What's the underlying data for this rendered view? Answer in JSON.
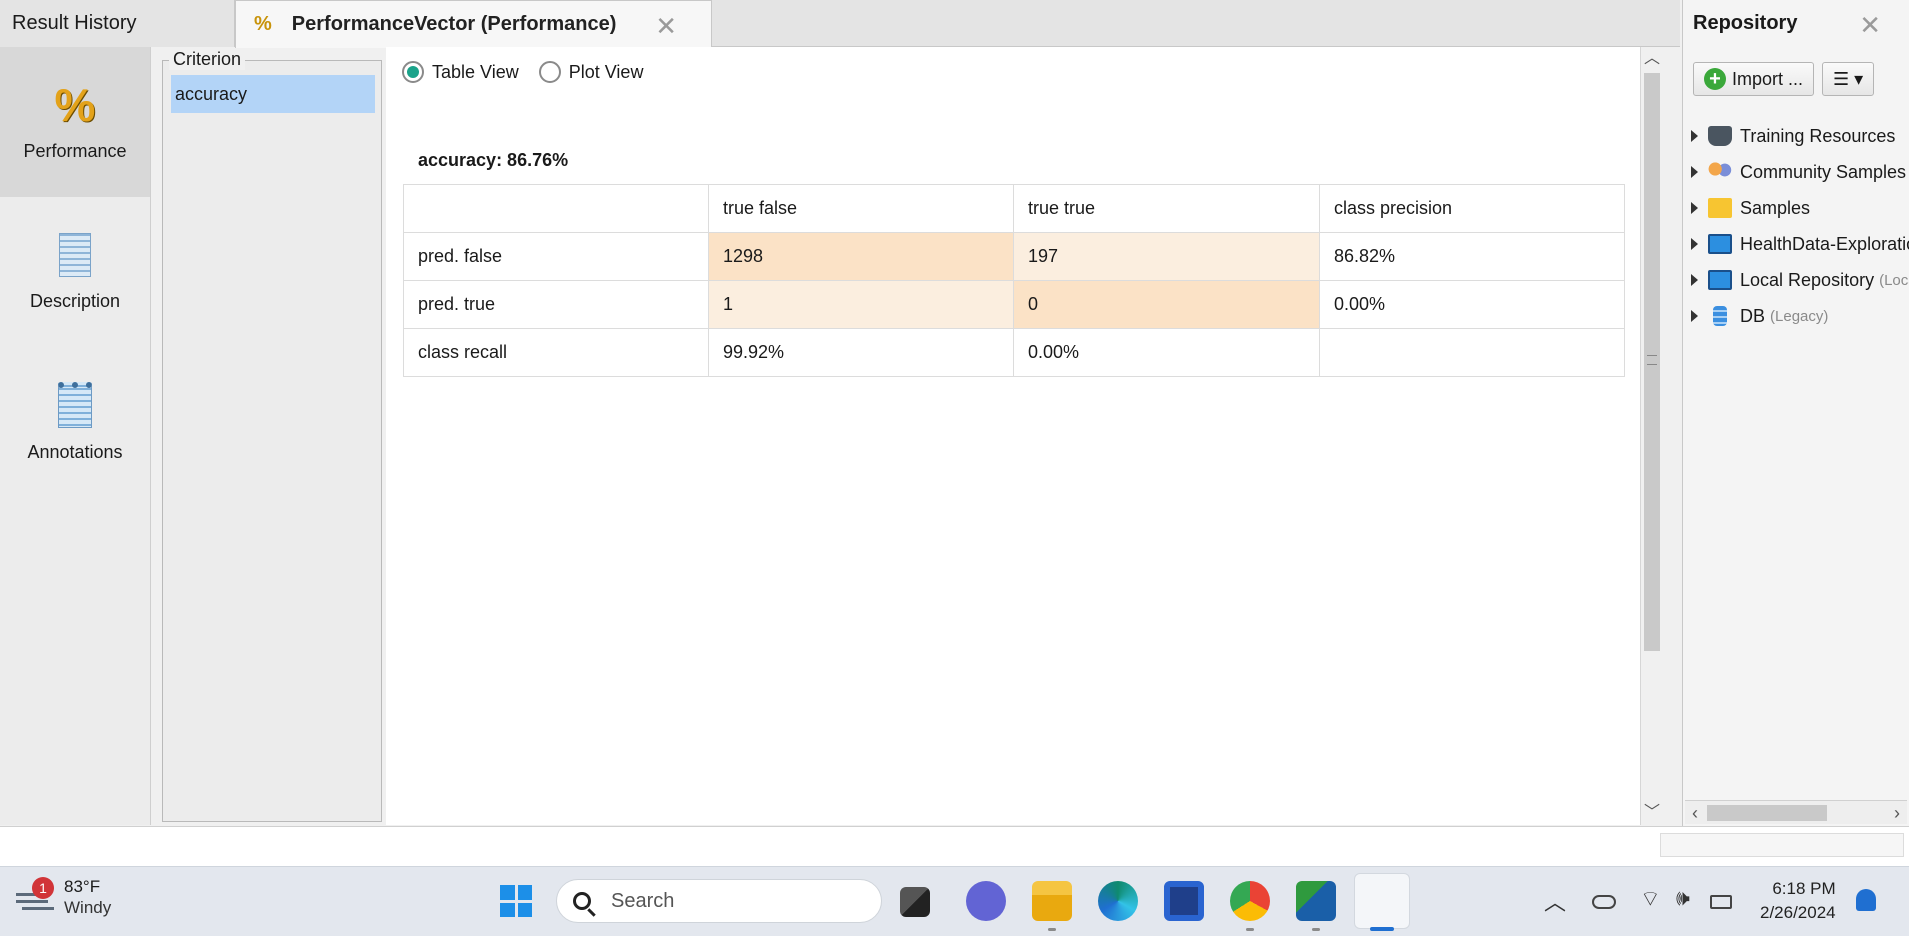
{
  "tabs": {
    "result_history": "Result History",
    "performance_tab": "PerformanceVector (Performance)",
    "performance_tab_icon": "%",
    "close_glyph": "✕"
  },
  "side_nav": {
    "items": [
      {
        "label": "Performance",
        "icon": "percent-icon",
        "active": true
      },
      {
        "label": "Description",
        "icon": "document-icon",
        "active": false
      },
      {
        "label": "Annotations",
        "icon": "notepad-icon",
        "active": false
      }
    ]
  },
  "criterion": {
    "title": "Criterion",
    "items": [
      "accuracy"
    ],
    "selected": "accuracy"
  },
  "view_toggle": {
    "table_view": "Table View",
    "plot_view": "Plot View",
    "selected": "Table View"
  },
  "performance": {
    "title": "accuracy: 86.76%",
    "header": [
      "",
      "true false",
      "true true",
      "class precision"
    ],
    "rows": [
      [
        "pred. false",
        "1298",
        "197",
        "86.82%"
      ],
      [
        "pred. true",
        "1",
        "0",
        "0.00%"
      ],
      [
        "class recall",
        "99.92%",
        "0.00%",
        ""
      ]
    ]
  },
  "repository": {
    "title": "Repository",
    "import_label": "Import ...",
    "menu_label": "☰ ▾",
    "tree": [
      {
        "label": "Training Resources",
        "suffix": "",
        "icon": "graduation-cap-icon"
      },
      {
        "label": "Community Samples",
        "suffix": "",
        "icon": "people-icon"
      },
      {
        "label": "Samples",
        "suffix": "",
        "icon": "folder-icon"
      },
      {
        "label": "HealthData-Exploration",
        "suffix": "",
        "icon": "monitor-icon"
      },
      {
        "label": "Local Repository",
        "suffix": "(Local)",
        "icon": "monitor-icon"
      },
      {
        "label": "DB",
        "suffix": "(Legacy)",
        "icon": "database-icon"
      }
    ]
  },
  "taskbar": {
    "weather": {
      "temp": "83°F",
      "condition": "Windy",
      "badge": "1"
    },
    "search_placeholder": "Search",
    "clock": {
      "time": "6:18 PM",
      "date": "2/26/2024"
    }
  },
  "colors": {
    "selection": "#b3d4f7",
    "cell_highlight": "#fbe2c6",
    "cell_light": "#fbeedf",
    "radio_accent": "#1ba38a",
    "accent_blue": "#1f6fd1"
  }
}
